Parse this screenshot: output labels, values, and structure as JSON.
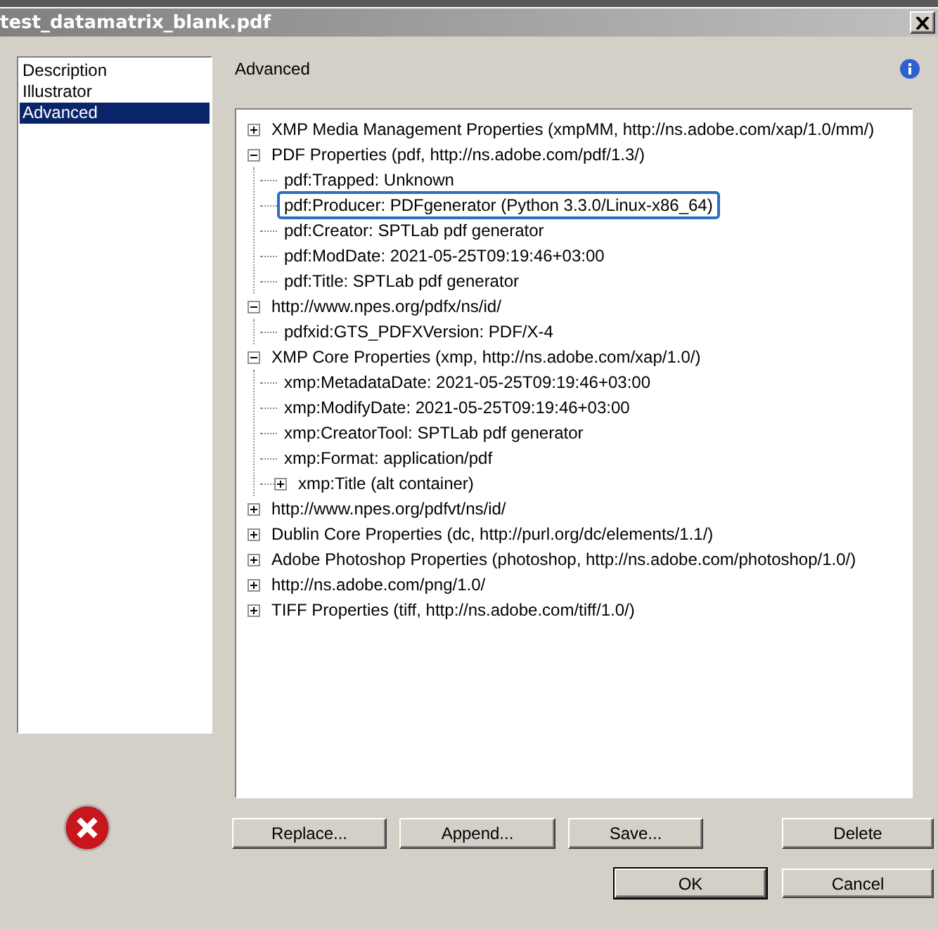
{
  "window": {
    "title": "test_datamatrix_blank.pdf"
  },
  "sidebar": {
    "items": [
      {
        "label": "Description",
        "selected": false
      },
      {
        "label": "Illustrator",
        "selected": false
      },
      {
        "label": "Advanced",
        "selected": true
      }
    ]
  },
  "panel": {
    "title": "Advanced"
  },
  "tree": {
    "nodes": [
      {
        "label": "XMP Media Management Properties (xmpMM, http://ns.adobe.com/xap/1.0/mm/)",
        "expanded": false,
        "selected": false
      },
      {
        "label": "PDF Properties (pdf, http://ns.adobe.com/pdf/1.3/)",
        "expanded": true,
        "selected": false,
        "children": [
          {
            "label": "pdf:Trapped: Unknown",
            "selected": false
          },
          {
            "label": "pdf:Producer: PDFgenerator (Python 3.3.0/Linux-x86_64)",
            "selected": true
          },
          {
            "label": "pdf:Creator: SPTLab pdf generator",
            "selected": false
          },
          {
            "label": "pdf:ModDate: 2021-05-25T09:19:46+03:00",
            "selected": false
          },
          {
            "label": "pdf:Title: SPTLab pdf generator",
            "selected": false
          }
        ]
      },
      {
        "label": "http://www.npes.org/pdfx/ns/id/",
        "expanded": true,
        "selected": false,
        "children": [
          {
            "label": "pdfxid:GTS_PDFXVersion: PDF/X-4",
            "selected": false
          }
        ]
      },
      {
        "label": "XMP Core Properties (xmp, http://ns.adobe.com/xap/1.0/)",
        "expanded": true,
        "selected": false,
        "children": [
          {
            "label": "xmp:MetadataDate: 2021-05-25T09:19:46+03:00",
            "selected": false
          },
          {
            "label": "xmp:ModifyDate: 2021-05-25T09:19:46+03:00",
            "selected": false
          },
          {
            "label": "xmp:CreatorTool: SPTLab pdf generator",
            "selected": false
          },
          {
            "label": "xmp:Format: application/pdf",
            "selected": false
          },
          {
            "label": "xmp:Title (alt container)",
            "expanded": false,
            "selected": false
          }
        ]
      },
      {
        "label": "http://www.npes.org/pdfvt/ns/id/",
        "expanded": false,
        "selected": false
      },
      {
        "label": "Dublin Core Properties (dc, http://purl.org/dc/elements/1.1/)",
        "expanded": false,
        "selected": false
      },
      {
        "label": "Adobe Photoshop Properties (photoshop, http://ns.adobe.com/photoshop/1.0/)",
        "expanded": false,
        "selected": false
      },
      {
        "label": "http://ns.adobe.com/png/1.0/",
        "expanded": false,
        "selected": false
      },
      {
        "label": "TIFF Properties (tiff, http://ns.adobe.com/tiff/1.0/)",
        "expanded": false,
        "selected": false
      }
    ]
  },
  "actions": [
    "Replace...",
    "Append...",
    "Save...",
    "Delete"
  ],
  "buttons": [
    {
      "label": "OK",
      "default": true
    },
    {
      "label": "Cancel",
      "default": false
    }
  ]
}
